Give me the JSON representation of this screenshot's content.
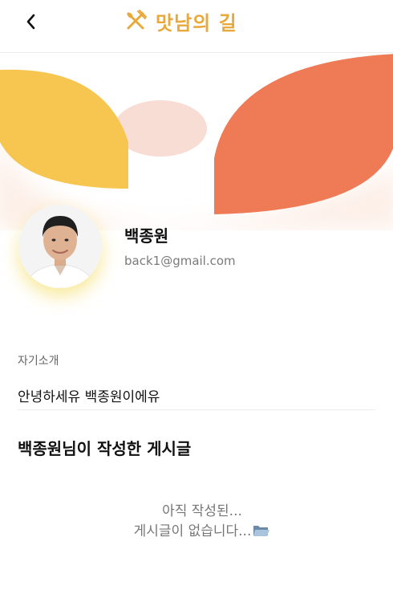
{
  "header": {
    "brand_title": "맛남의 길",
    "back_icon": "chevron-left-icon",
    "brand_icon": "fork-knife-icon",
    "brand_color": "#e8a93a"
  },
  "banner": {
    "colors": {
      "left_leaf": "#f6c651",
      "right_leaf": "#ee7a56",
      "center_oval": "#f7ddd4"
    }
  },
  "profile": {
    "name": "백종원",
    "email": "back1@gmail.com",
    "avatar_icon": "avatar-photo"
  },
  "intro": {
    "label": "자기소개",
    "text": "안녕하세유 백종원이에유"
  },
  "posts": {
    "title": "백종원님이 작성한 게시글",
    "empty_line1": "아직 작성된...",
    "empty_line2": "게시글이 없습니다...",
    "empty_icon": "open-folder-icon"
  }
}
